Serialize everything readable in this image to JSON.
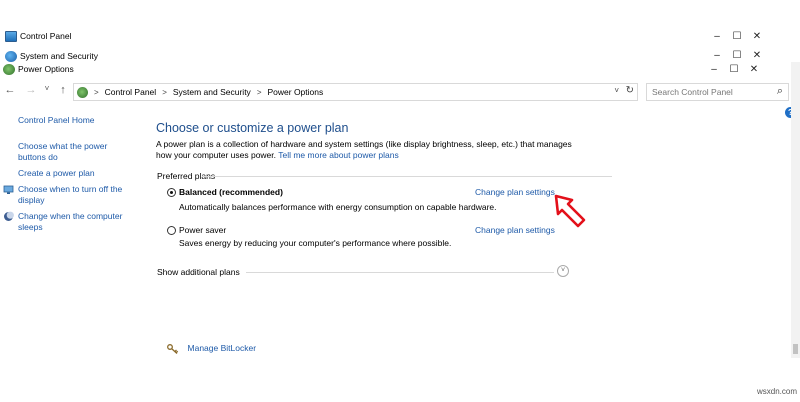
{
  "windows": [
    {
      "title": "Control Panel",
      "icon": "control-panel-icon"
    },
    {
      "title": "System and Security",
      "icon": "system-security-icon"
    },
    {
      "title": "Power Options",
      "icon": "power-options-icon"
    }
  ],
  "window_controls": {
    "minimize": "–",
    "maximize": "☐",
    "close": "✕"
  },
  "nav": {
    "back": "←",
    "forward": "→",
    "recent": "˅",
    "up": "↑"
  },
  "address": {
    "crumbs": [
      "Control Panel",
      "System and Security",
      "Power Options"
    ],
    "dropdown": "˅",
    "refresh": "↻"
  },
  "search": {
    "placeholder": "Search Control Panel",
    "icon": "⌕"
  },
  "help": "?",
  "sidebar": {
    "items": [
      {
        "label": "Control Panel Home"
      },
      {
        "label_line1": "Choose what the power",
        "label_line2": "buttons do"
      },
      {
        "label": "Create a power plan"
      },
      {
        "label_line1": "Choose when to turn off the",
        "label_line2": "display"
      },
      {
        "label_line1": "Change when the computer",
        "label_line2": "sleeps"
      }
    ]
  },
  "main": {
    "heading": "Choose or customize a power plan",
    "desc_line1": "A power plan is a collection of hardware and system settings (like display brightness, sleep, etc.) that manages",
    "desc_line2": "how your computer uses power.",
    "desc_link": "Tell me more about power plans",
    "preferred_plans": "Preferred plans",
    "plans": [
      {
        "name": "Balanced (recommended)",
        "description": "Automatically balances performance with energy consumption on capable hardware.",
        "link": "Change plan settings",
        "selected": true
      },
      {
        "name": "Power saver",
        "description": "Saves energy by reducing your computer's performance where possible.",
        "link": "Change plan settings",
        "selected": false
      }
    ],
    "show_additional": "Show additional plans",
    "expand_icon": "˅"
  },
  "see_also": {
    "bitlocker": "Manage BitLocker"
  },
  "watermark": "wsxdn.com",
  "colors": {
    "link": "#1e5aa8",
    "heading": "#1e4e8c",
    "annotation_arrow": "#e3101a"
  }
}
